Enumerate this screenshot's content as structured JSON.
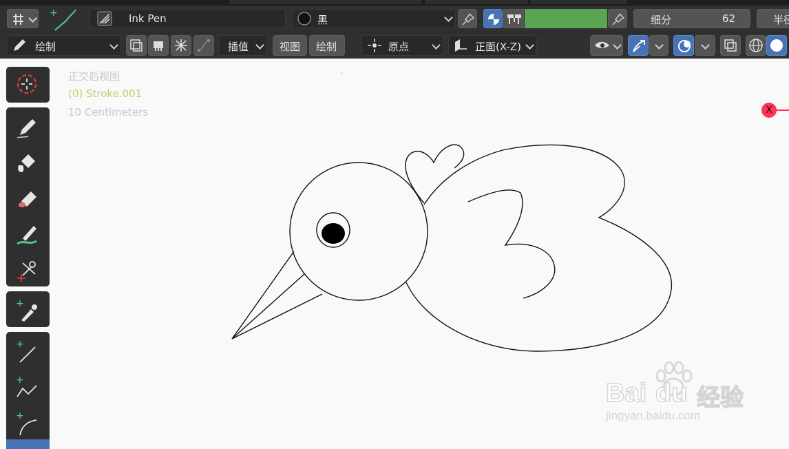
{
  "header": {
    "brush_name": "Ink Pen",
    "material_name": "黑",
    "subdivide_label": "细分",
    "subdivide_value": "62",
    "radius_label": "半径"
  },
  "toolbar": {
    "mode_label": "绘制",
    "interpolate_label": "插值",
    "view_menu": "视图",
    "draw_menu": "绘制",
    "origin_label": "原点",
    "orientation_label": "正面(X-Z)"
  },
  "viewport": {
    "view_name": "正交后视图",
    "object_name": "(0) Stroke.001",
    "scale_label": "10 Centimeters",
    "axis_x_label": "X"
  },
  "tools": [
    "cursor-tool",
    "draw-tool",
    "fill-tool",
    "erase-tool",
    "tint-tool",
    "cutter-tool",
    "eyedropper-tool",
    "line-tool",
    "polyline-tool",
    "arc-tool"
  ],
  "watermark": {
    "brand": "Bai",
    "brand2": "du",
    "brand_cn": "经验",
    "url": "jingyan.baidu.com"
  },
  "colors": {
    "header_bg": "#303030",
    "viewport_bg": "#f9f9f9",
    "accent_blue": "#4772b3",
    "material_green": "#5aa552",
    "object_name_green": "#b4d36c",
    "axis_x_red": "#ff3352"
  }
}
